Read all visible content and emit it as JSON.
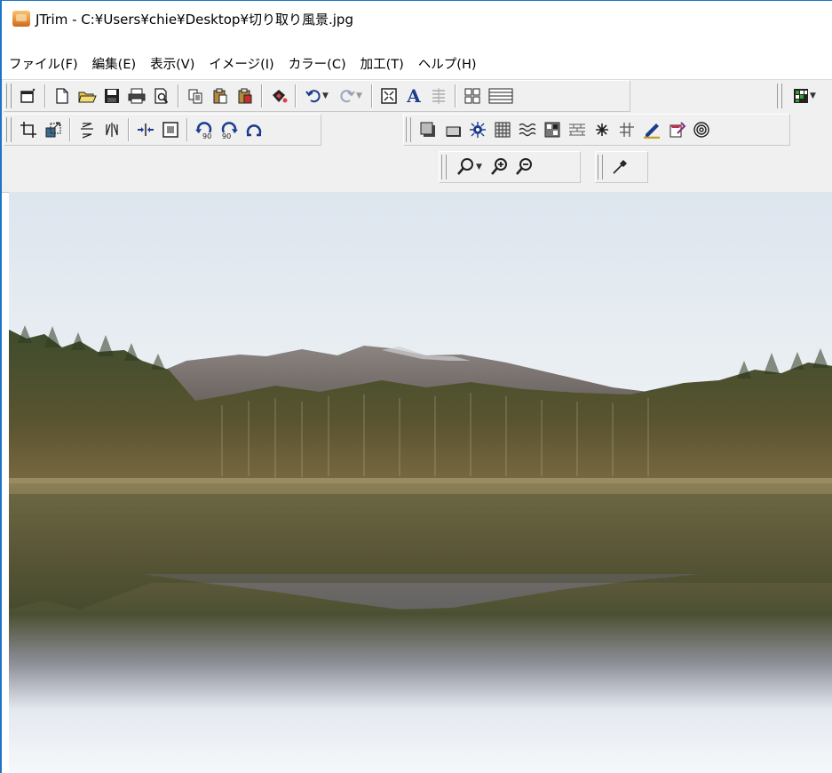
{
  "window": {
    "title": "JTrim - C:¥Users¥chie¥Desktop¥切り取り風景.jpg",
    "icon": "jtrim-app-icon"
  },
  "menu": [
    {
      "label": "ファイル(F)"
    },
    {
      "label": "編集(E)"
    },
    {
      "label": "表示(V)"
    },
    {
      "label": "イメージ(I)"
    },
    {
      "label": "カラー(C)"
    },
    {
      "label": "加工(T)"
    },
    {
      "label": "ヘルプ(H)"
    }
  ],
  "toolbar1": [
    "new-window-icon",
    "new-file-icon",
    "open-folder-icon",
    "save-icon",
    "print-icon",
    "print-preview-icon",
    "copy-icon",
    "paste-icon",
    "paste-new-icon",
    "color-fill-icon",
    "undo-icon",
    "redo-icon",
    "fit-window-icon",
    "text-icon",
    "align-icon",
    "grid-view-icon",
    "film-icon",
    "color-palette-icon"
  ],
  "toolbar2": [
    "trim-icon",
    "resize-icon",
    "flip-vertical-icon",
    "flip-horizontal-icon",
    "margin-icon",
    "frame-icon",
    "rotate-left-90-icon",
    "rotate-right-90-icon",
    "rotate-free-icon"
  ],
  "toolbar3": [
    "shadow-icon",
    "bevel-icon",
    "lens-flare-icon",
    "mosaic-icon",
    "wave-icon",
    "noise-icon",
    "brick-icon",
    "sparkle-icon",
    "line-icon",
    "pencil-icon",
    "eraser-icon",
    "spiral-icon"
  ],
  "toolbar4": [
    "zoom-icon",
    "zoom-in-icon",
    "zoom-out-icon"
  ],
  "toolbar5": [
    "eyedropper-icon"
  ],
  "image": {
    "description_name": "landscape-lake-image",
    "sky_top": "#dfe6ef",
    "sky_bottom": "#f1f4f5",
    "mountain": "#7d7571",
    "forest": "#3f4a2a",
    "water": "#6a6040",
    "reflection_fade": "#e9eef4"
  }
}
